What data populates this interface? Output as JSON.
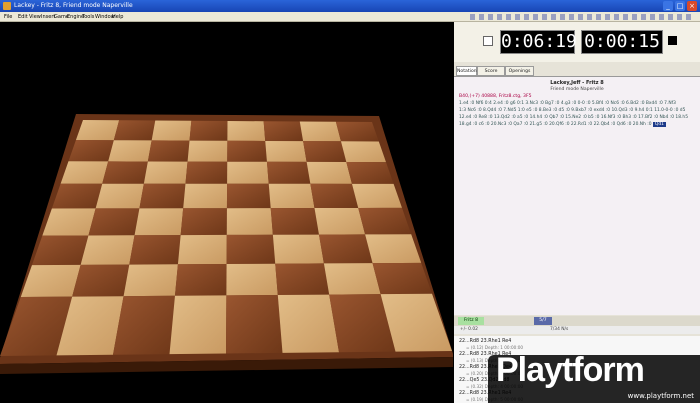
{
  "window": {
    "title": "Lackey - Fritz 8, Friend mode Naperville",
    "controls": {
      "minimize": "_",
      "maximize": "□",
      "close": "×"
    }
  },
  "menu": [
    "File",
    "Edit",
    "View",
    "Insert",
    "Game",
    "Engine",
    "Tools",
    "Window",
    "Help"
  ],
  "clocks": {
    "white": "0:06:19",
    "black": "0:00:15"
  },
  "tabs": [
    "Notation",
    "Score sheet",
    "Openings Book"
  ],
  "notation": {
    "title": "Lackey,Jeff - Fritz 8",
    "subtitle": "Friend mode Naperville",
    "eco": "B40,(+7) 40888, Fritz8.ctg, 3F5",
    "lines": [
      "1.e4 :0 Nf6 0:4 2.e4 :0 g6 0:1 3.Nc3 :0 Bg7 :0 4.g3 :0 0-0 :0 5.Bf4 :0 Nc6 :0 6.Bd2 :0 Bxd4 :0 7.Nf3",
      "1:3 Nc6 :0 8.Qd4 :0 7.Nd5 1:0 e5 :0 8.Be3 :0 d5 :0 9.Bxb7 :0 exd4 :0 10.Qd3 :0 9.h4 0:1 11.0-0-0 :0 d5",
      "12.e4 :0 Re8 :0 13.Qd2 :0 a5 :0 14.h4 :0 Qb7 :0 15.Ne2 :0 b5 :0 16.Nf3 :0 Bh3 :0 17.Bf2 :0 Nb4 :0 18.h5",
      "18.g4 :0 c6 :0 20.Nc3 :0 Qa7 :0 21.g5 :0 20.Qf6 :0 22.Rd1 :0 22.Qb4 :0 Qd6 :0 20.Nh :0"
    ],
    "current_move": "Qd1"
  },
  "engine": {
    "name": "Fritz 8",
    "depth_label": "5/7",
    "stats": [
      "+/- 0.02",
      "7/34 N/s"
    ]
  },
  "analysis": [
    {
      "move": "22...Rd8 23.Rhe1 Re4",
      "sub": "= (0.12)   Depth: 1   00:00:00"
    },
    {
      "move": "22...Rd8 23.Rhe1 Re4",
      "sub": "= (0.13)   Depth: 2   00:00:00"
    },
    {
      "move": "22...Rd8 23.Rhe1 Qe4",
      "sub": "= (0.20)   Depth: 3   00:00:00"
    },
    {
      "move": "22...Qe5 23.Qd2 Rd8",
      "sub": "= (0.32)   Depth: 4   00:00:00"
    },
    {
      "move": "22...Rd8 23.Rhe1 Re4",
      "sub": "= (0.19)   Depth: 5   00:00:00"
    }
  ],
  "watermark": {
    "logo": "Playtform",
    "url": "www.playtform.net"
  },
  "colors": {
    "titlebar": "#1f55c8",
    "board_light": "#d7b07a",
    "board_dark": "#8a4a26",
    "frame": "#6a3418",
    "white_piece": "#ead6b4",
    "black_piece": "#5a3a22"
  }
}
